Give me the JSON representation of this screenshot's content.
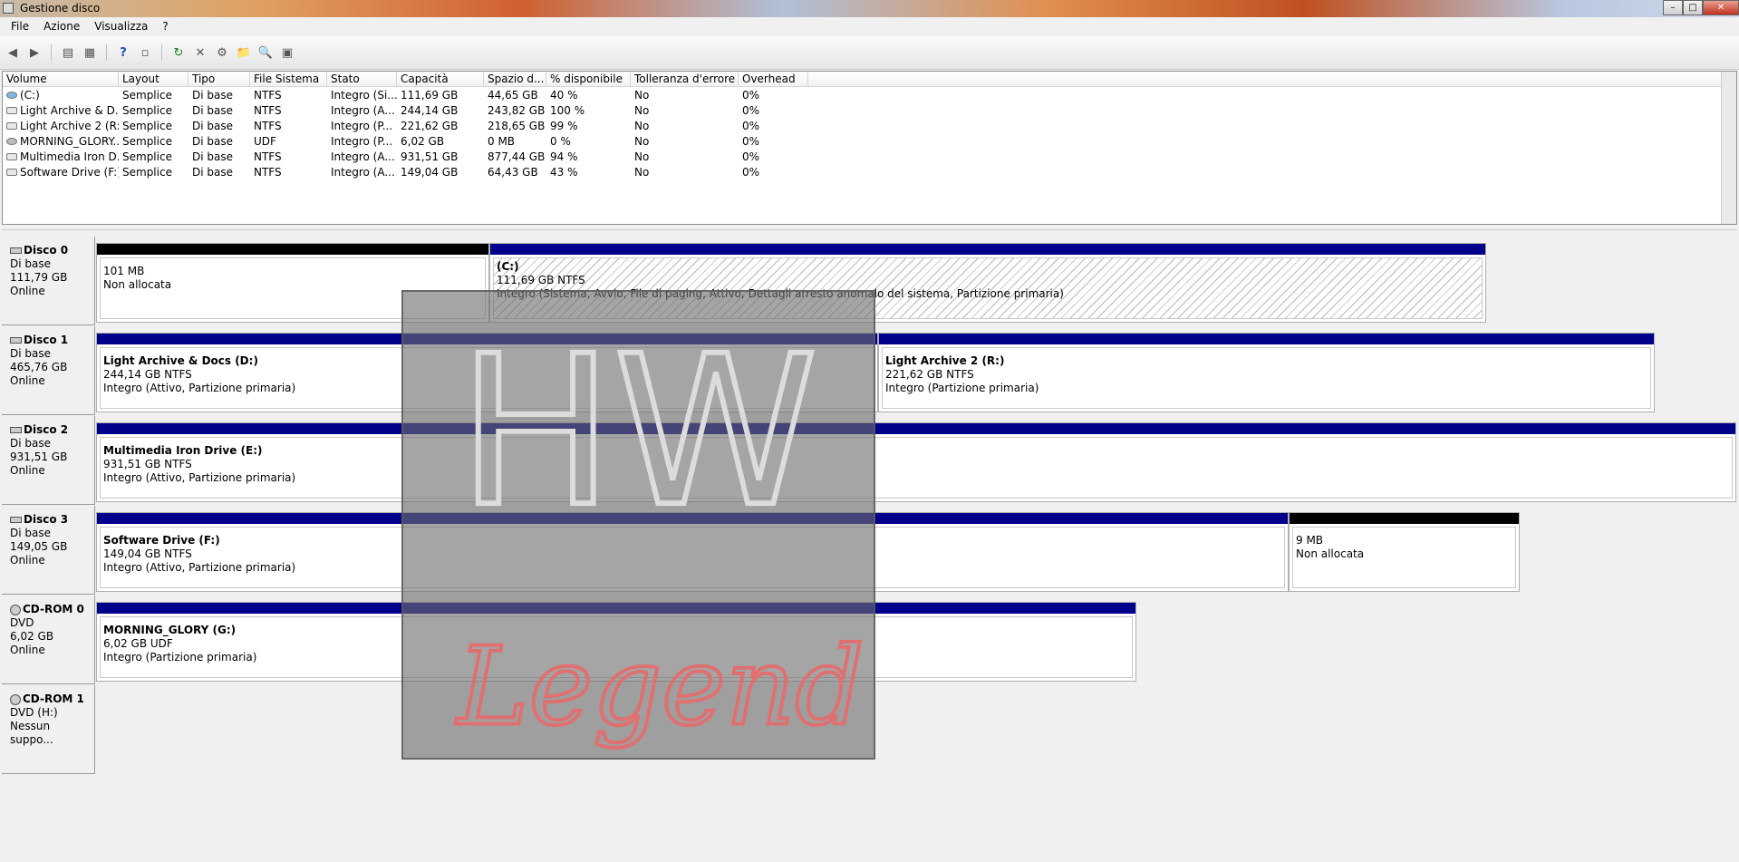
{
  "window": {
    "title": "Gestione disco",
    "btn_minimize": "–",
    "btn_maximize": "□",
    "btn_close": "✕"
  },
  "menu": [
    "File",
    "Azione",
    "Visualizza",
    "?"
  ],
  "toolbar": {
    "icons": [
      "back-icon",
      "forward-icon",
      "console-tree-icon",
      "help-icon",
      "properties-icon",
      "refresh-icon",
      "delete-icon",
      "settings-icon",
      "open-icon",
      "explore-icon",
      "rescan-icon"
    ]
  },
  "volume_table": {
    "columns": [
      "Volume",
      "Layout",
      "Tipo",
      "File Sistema",
      "Stato",
      "Capacità",
      "Spazio d...",
      "% disponibile",
      "Tolleranza d'errore",
      "Overhead"
    ],
    "rows": [
      [
        "(C:)",
        "Semplice",
        "Di base",
        "NTFS",
        "Integro (Si...",
        "111,69 GB",
        "44,65 GB",
        "40 %",
        "No",
        "0%"
      ],
      [
        "Light Archive & D...",
        "Semplice",
        "Di base",
        "NTFS",
        "Integro (A...",
        "244,14 GB",
        "243,82 GB",
        "100 %",
        "No",
        "0%"
      ],
      [
        "Light Archive 2 (R:)",
        "Semplice",
        "Di base",
        "NTFS",
        "Integro (P...",
        "221,62 GB",
        "218,65 GB",
        "99 %",
        "No",
        "0%"
      ],
      [
        "MORNING_GLORY...",
        "Semplice",
        "Di base",
        "UDF",
        "Integro (P...",
        "6,02 GB",
        "0 MB",
        "0 %",
        "No",
        "0%"
      ],
      [
        "Multimedia Iron D...",
        "Semplice",
        "Di base",
        "NTFS",
        "Integro (A...",
        "931,51 GB",
        "877,44 GB",
        "94 %",
        "No",
        "0%"
      ],
      [
        "Software Drive (F:)",
        "Semplice",
        "Di base",
        "NTFS",
        "Integro (A...",
        "149,04 GB",
        "64,43 GB",
        "43 %",
        "No",
        "0%"
      ]
    ]
  },
  "disks": [
    {
      "name": "Disco 0",
      "type": "Di base",
      "size": "111,79 GB",
      "status": "Online",
      "partitions": [
        {
          "label": "",
          "size": "101 MB",
          "desc": "Non allocata"
        },
        {
          "label": "(C:)",
          "size": "111,69 GB NTFS",
          "desc": "Integro (Sistema, Avvio, File di paging, Attivo, Dettagli arresto anomalo del sistema, Partizione primaria)"
        }
      ]
    },
    {
      "name": "Disco 1",
      "type": "Di base",
      "size": "465,76 GB",
      "status": "Online",
      "partitions": [
        {
          "label": "Light Archive & Docs  (D:)",
          "size": "244,14 GB NTFS",
          "desc": "Integro (Attivo, Partizione primaria)"
        },
        {
          "label": "Light Archive 2  (R:)",
          "size": "221,62 GB NTFS",
          "desc": "Integro (Partizione primaria)"
        }
      ]
    },
    {
      "name": "Disco 2",
      "type": "Di base",
      "size": "931,51 GB",
      "status": "Online",
      "partitions": [
        {
          "label": "Multimedia Iron Drive  (E:)",
          "size": "931,51 GB NTFS",
          "desc": "Integro (Attivo, Partizione primaria)"
        }
      ]
    },
    {
      "name": "Disco 3",
      "type": "Di base",
      "size": "149,05 GB",
      "status": "Online",
      "partitions": [
        {
          "label": "Software Drive  (F:)",
          "size": "149,04 GB NTFS",
          "desc": "Integro (Attivo, Partizione primaria)"
        },
        {
          "label": "",
          "size": "9 MB",
          "desc": "Non allocata"
        }
      ]
    },
    {
      "name": "CD-ROM 0",
      "type": "DVD",
      "size": "6,02 GB",
      "status": "Online",
      "partitions": [
        {
          "label": "MORNING_GLORY  (G:)",
          "size": "6,02 GB UDF",
          "desc": "Integro (Partizione primaria)"
        }
      ]
    },
    {
      "name": "CD-ROM 1",
      "type": "DVD (H:)",
      "size": "",
      "status": "Nessun suppo..."
    }
  ],
  "watermark": {
    "line1": "HW",
    "line2": "Legend"
  },
  "colors": {
    "primary_partition": "#00008b",
    "unallocated": "#000000"
  }
}
